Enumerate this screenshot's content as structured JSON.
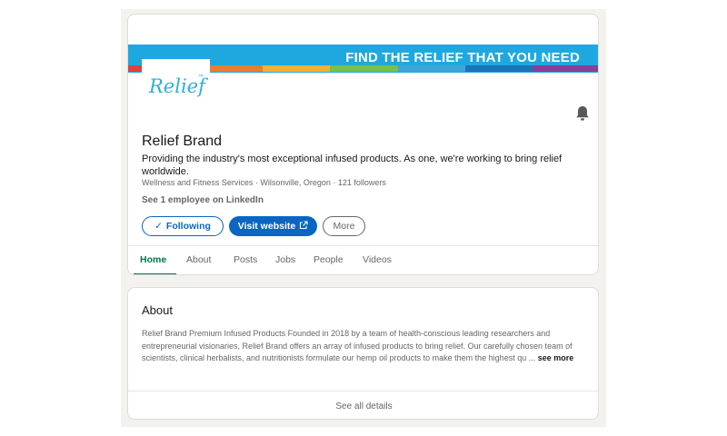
{
  "banner": {
    "text": "FIND THE RELIEF THAT YOU NEED",
    "stripe_colors": [
      "#e0413a",
      "#eb7d2c",
      "#f3b033",
      "#7ac143",
      "#3fa4d8",
      "#1d73b9",
      "#8a3e97"
    ]
  },
  "logo": {
    "text": "Relief",
    "tm": "™"
  },
  "company": {
    "name": "Relief Brand",
    "tagline": "Providing the industry's most exceptional infused products. As one, we're working to bring relief worldwide.",
    "meta": "Wellness and Fitness Services · Wilsonville, Oregon · 121 followers",
    "employees": "See 1 employee on LinkedIn"
  },
  "actions": {
    "following_label": "Following",
    "following_icon": "✓",
    "visit_label": "Visit website",
    "more_label": "More"
  },
  "tabs": {
    "home": "Home",
    "about": "About",
    "posts": "Posts",
    "jobs": "Jobs",
    "people": "People",
    "videos": "Videos"
  },
  "about": {
    "title": "About",
    "text": "Relief Brand Premium Infused Products Founded in 2018 by a team of health-conscious leading researchers and entrepreneurial visionaries, Relief Brand offers an array of infused products to bring relief. Our carefully chosen team of scientists, clinical herbalists, and nutritionists formulate our hemp oil products to make them the highest qu ...",
    "see_more": "see more",
    "see_all": "See all details"
  },
  "colors": {
    "accent_blue": "#0a66c2",
    "banner_blue": "#1fa8df",
    "tab_active": "#01754f"
  },
  "icons": {
    "bell": "bell-icon",
    "check": "checkmark-icon",
    "external": "external-link-icon"
  }
}
